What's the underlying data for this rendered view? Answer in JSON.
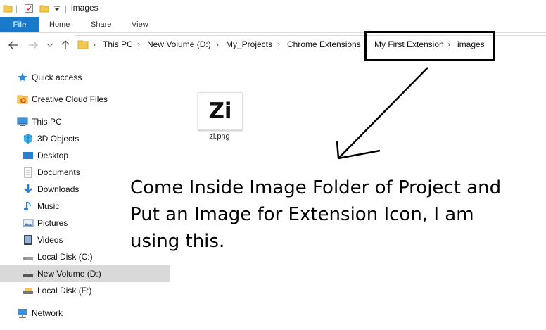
{
  "window": {
    "title": "images"
  },
  "ribbon": {
    "file_label": "File",
    "tabs": [
      "Home",
      "Share",
      "View"
    ]
  },
  "address": {
    "crumbs": [
      "This PC",
      "New Volume (D:)",
      "My_Projects",
      "Chrome Extensions",
      "My First Extension",
      "images"
    ],
    "separator": "›"
  },
  "nav": {
    "items": [
      {
        "label": "Quick access",
        "icon": "star-icon"
      },
      {
        "label": "Creative Cloud Files",
        "icon": "creative-cloud-folder-icon"
      },
      {
        "label": "This PC",
        "icon": "computer-icon"
      },
      {
        "label": "3D Objects",
        "icon": "3d-objects-icon"
      },
      {
        "label": "Desktop",
        "icon": "desktop-icon"
      },
      {
        "label": "Documents",
        "icon": "documents-icon"
      },
      {
        "label": "Downloads",
        "icon": "downloads-icon"
      },
      {
        "label": "Music",
        "icon": "music-icon"
      },
      {
        "label": "Pictures",
        "icon": "pictures-icon"
      },
      {
        "label": "Videos",
        "icon": "videos-icon"
      },
      {
        "label": "Local Disk (C:)",
        "icon": "drive-icon"
      },
      {
        "label": "New Volume (D:)",
        "icon": "drive-icon"
      },
      {
        "label": "Local Disk (F:)",
        "icon": "drive-icon"
      },
      {
        "label": "Network",
        "icon": "network-icon"
      }
    ],
    "selected": "New Volume (D:)"
  },
  "content": {
    "file": {
      "thumb_text": "Zi",
      "name": "zi.png"
    },
    "caption": "Come Inside Image Folder of Project and Put an Image for Extension Icon, I am using this."
  },
  "colors": {
    "accent": "#1979ca",
    "selected_bg": "#d9d9d9",
    "annotation": "#000000"
  }
}
